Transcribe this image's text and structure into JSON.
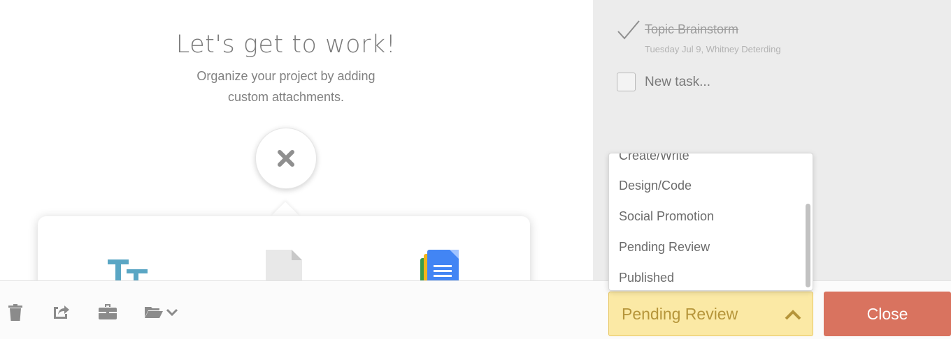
{
  "main": {
    "title": "Let's get to work!",
    "subtitle": "Organize your project by adding custom attachments."
  },
  "attachments": {
    "items": [
      {
        "name": "text",
        "icon": "text-format-icon"
      },
      {
        "name": "file",
        "icon": "file-icon"
      },
      {
        "name": "google-docs",
        "icon": "google-docs-icon"
      }
    ]
  },
  "tasks": {
    "completed": {
      "label": "Topic Brainstorm",
      "meta": "Tuesday Jul 9,  Whitney Deterding"
    },
    "new_task_placeholder": "New task..."
  },
  "status_dropdown": {
    "options": [
      "Create/Write",
      "Design/Code",
      "Social Promotion",
      "Pending Review",
      "Published"
    ],
    "selected": "Pending Review"
  },
  "toolbar": {
    "icons": [
      "trash-icon",
      "share-icon",
      "briefcase-icon",
      "folder-icon"
    ],
    "close_label": "Close"
  },
  "colors": {
    "status_bg": "#fbe9a5",
    "status_text": "#b6953a",
    "close_bg": "#d9735f",
    "right_panel_bg": "#ececec"
  }
}
